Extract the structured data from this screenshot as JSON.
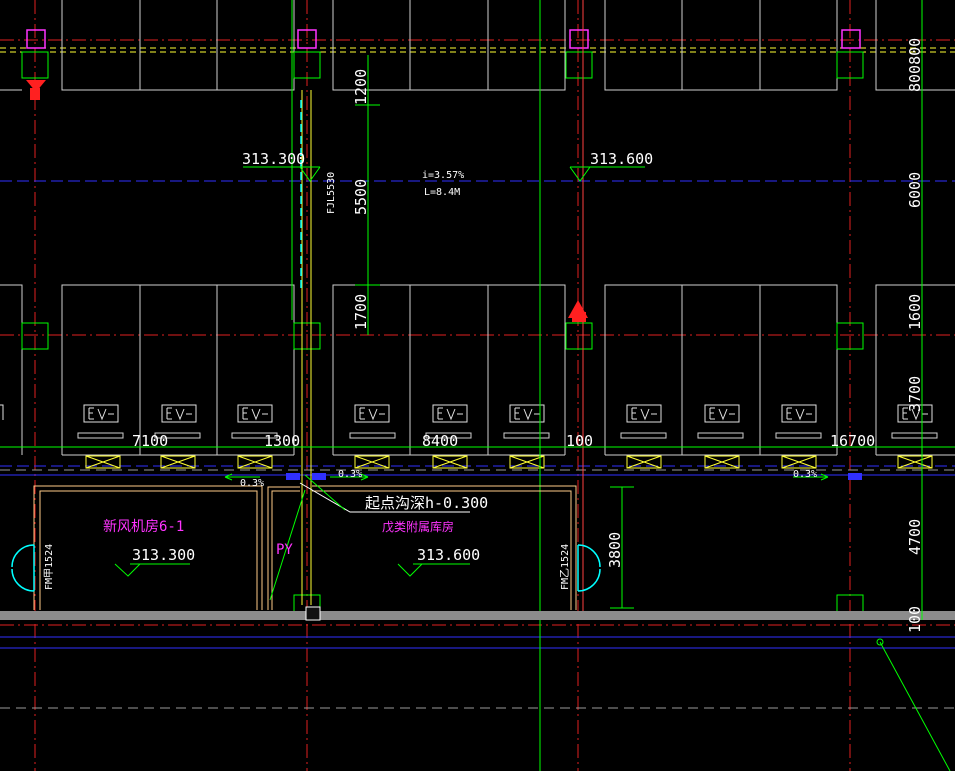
{
  "elevations": {
    "left_top": "313.300",
    "right_top": "313.600",
    "room1": "313.300",
    "room2": "313.600"
  },
  "slope": {
    "ratio": "i=3.57%",
    "length": "L=8.4M",
    "pct_1": "0.3%",
    "pct_2": "0.3%",
    "pct_3": "0.3%"
  },
  "vertical_dims_left": [
    "1200",
    "5500",
    "1700"
  ],
  "vertical_dims_right": [
    "800800",
    "6000",
    "1600",
    "3700",
    "4700",
    "100"
  ],
  "horizontal_dims": [
    "7100",
    "1300",
    "8400",
    "100",
    "16700"
  ],
  "dim_3800": "3800",
  "drain_label": "FJL5530",
  "trench_start": "起点沟深h-0.300",
  "rooms": {
    "room1_name": "新风机房6-1",
    "room2_name": "戊类附属库房",
    "door1": "FM甲1524",
    "door2": "FM乙1524",
    "py": "PY"
  },
  "colors": {
    "background": "#000000",
    "grid_red": "#ff2020",
    "structure_white": "#d8d8d8",
    "green": "#00ff00",
    "blue": "#3030ff",
    "magenta": "#ff33ff",
    "yellow": "#ffff33",
    "cyan": "#00ffff"
  }
}
